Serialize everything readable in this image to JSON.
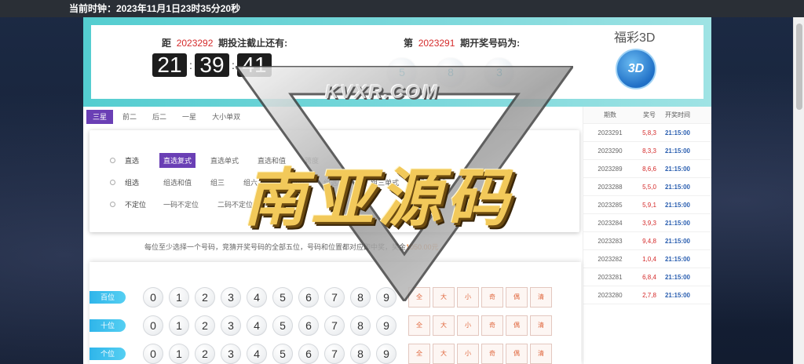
{
  "topbar": {
    "clock": "当前时钟：2023年11月1日23时35分20秒"
  },
  "deadline": {
    "prefix": "距",
    "issue": "2023292",
    "suffix": "期投注截止还有:"
  },
  "countdown": {
    "hours": "21",
    "minutes": "39",
    "seconds": "41",
    "sep": ":"
  },
  "draw": {
    "prefix": "第",
    "issue": "2023291",
    "suffix": "期开奖号码为:",
    "balls": [
      "5",
      "8",
      "3"
    ]
  },
  "brand": {
    "title": "福彩3D",
    "logo": "3D"
  },
  "tabs": [
    {
      "label": "三星",
      "active": true
    },
    {
      "label": "前二",
      "active": false
    },
    {
      "label": "后二",
      "active": false
    },
    {
      "label": "一星",
      "active": false
    },
    {
      "label": "大小单双",
      "active": false
    }
  ],
  "options": {
    "row1": {
      "label": "直选",
      "items": [
        "直选复式",
        "直选单式",
        "直选和值",
        "跨度"
      ]
    },
    "row2": {
      "label": "组选",
      "items": [
        "组选和值",
        "组三",
        "组六",
        "组选包胆",
        "组选包号",
        "组三单式",
        "组六单式"
      ]
    },
    "row3": {
      "label": "不定位",
      "items": [
        "一码不定位",
        "二码不定位"
      ]
    }
  },
  "hint": {
    "text": "每位至少选择一个号码，竞猜开奖号码的全部五位，号码和位置都对应即中奖，奖金",
    "amount": "1050.00元"
  },
  "history": {
    "headers": {
      "issue": "期数",
      "nums": "奖号",
      "time": "开奖时间"
    },
    "rows": [
      {
        "issue": "2023291",
        "nums": "5,8,3",
        "time": "21:15:00"
      },
      {
        "issue": "2023290",
        "nums": "8,3,3",
        "time": "21:15:00"
      },
      {
        "issue": "2023289",
        "nums": "8,6,6",
        "time": "21:15:00"
      },
      {
        "issue": "2023288",
        "nums": "5,5,0",
        "time": "21:15:00"
      },
      {
        "issue": "2023285",
        "nums": "5,9,1",
        "time": "21:15:00"
      },
      {
        "issue": "2023284",
        "nums": "3,9,3",
        "time": "21:15:00"
      },
      {
        "issue": "2023283",
        "nums": "9,4,8",
        "time": "21:15:00"
      },
      {
        "issue": "2023282",
        "nums": "1,0,4",
        "time": "21:15:00"
      },
      {
        "issue": "2023281",
        "nums": "6,8,4",
        "time": "21:15:00"
      },
      {
        "issue": "2023280",
        "nums": "2,7,8",
        "time": "21:15:00"
      }
    ]
  },
  "picker": {
    "positions": [
      "百位",
      "十位",
      "个位"
    ],
    "digits": [
      "0",
      "1",
      "2",
      "3",
      "4",
      "5",
      "6",
      "7",
      "8",
      "9"
    ],
    "quick": [
      "全",
      "大",
      "小",
      "奇",
      "偶",
      "清"
    ]
  },
  "watermark": {
    "site": "KVXR.COM",
    "big": "南亚源码"
  },
  "colors": {
    "accent": "#6a3fb5",
    "teal": "#54cdd0",
    "red": "#d52b2b",
    "blue": "#2b5fb0"
  }
}
